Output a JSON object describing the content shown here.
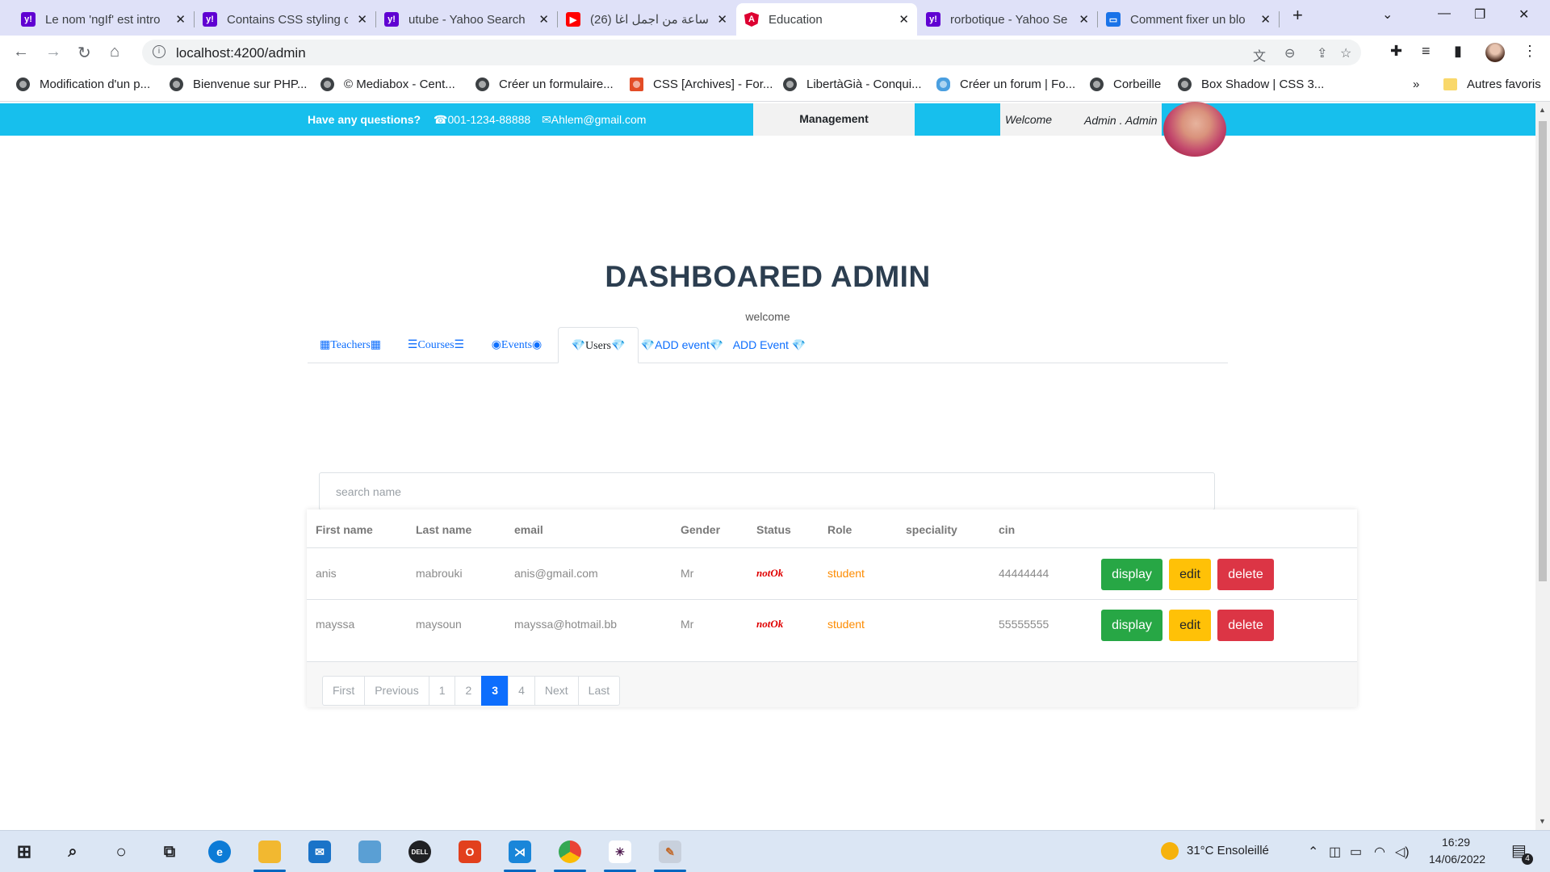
{
  "browser": {
    "tabs": [
      {
        "title": "Le nom 'ngIf' est intro",
        "icon": "yahoo-icon",
        "color": "#6001d2",
        "active": false
      },
      {
        "title": "Contains CSS styling c",
        "icon": "yahoo-icon",
        "color": "#6001d2",
        "active": false
      },
      {
        "title": "utube - Yahoo Search",
        "icon": "yahoo-icon",
        "color": "#6001d2",
        "active": false
      },
      {
        "title": "(26) ساعة من اجمل اغا",
        "icon": "youtube-icon",
        "color": "#ff0000",
        "active": false
      },
      {
        "title": "Education",
        "icon": "angular-icon",
        "color": "#dd0031",
        "active": true
      },
      {
        "title": "rorbotique - Yahoo Se",
        "icon": "yahoo-icon",
        "color": "#6001d2",
        "active": false
      },
      {
        "title": "Comment fixer un blo",
        "icon": "monitor-icon",
        "color": "#1a73e8",
        "active": false
      }
    ],
    "url": "localhost:4200/admin",
    "bookmarks": [
      "Modification d'un p...",
      "Bienvenue sur PHP...",
      "© Mediabox - Cent...",
      "Créer un formulaire...",
      "CSS [Archives] - For...",
      "LibertàGià - Conqui...",
      "Créer un forum | Fo...",
      "Corbeille",
      "Box Shadow | CSS 3..."
    ],
    "bookmarks_more": "»",
    "other_bookmarks": "Autres favoris"
  },
  "topbar": {
    "question": "Have any questions?",
    "phone": "☎001-1234-88888",
    "email": "✉Ahlem@gmail.com",
    "management": "Management",
    "welcome": "Welcome",
    "user": "Admin . Admin"
  },
  "dashboard": {
    "title": "DASHBOARED ADMIN",
    "subtitle": "welcome",
    "tabs": [
      {
        "label": "▦Teachers▦",
        "active": false
      },
      {
        "label": "☰Courses☰",
        "active": false
      },
      {
        "label": "◉Events◉",
        "active": false
      },
      {
        "label": "💎Users💎",
        "active": true
      },
      {
        "label": "💎ADD event💎",
        "active": false
      },
      {
        "label": "ADD Event 💎",
        "active": false
      }
    ],
    "search_placeholder": "search name"
  },
  "table": {
    "headers": [
      "First name",
      "Last name",
      "email",
      "Gender",
      "Status",
      "Role",
      "speciality",
      "cin"
    ],
    "rows": [
      {
        "first": "anis",
        "last": "mabrouki",
        "email": "anis@gmail.com",
        "gender": "Mr",
        "status": "notOk",
        "role": "student",
        "speciality": "",
        "cin": "44444444"
      },
      {
        "first": "mayssa",
        "last": "maysoun",
        "email": "mayssa@hotmail.bb",
        "gender": "Mr",
        "status": "notOk",
        "role": "student",
        "speciality": "",
        "cin": "55555555"
      }
    ],
    "actions": {
      "display": "display",
      "edit": "edit",
      "delete": "delete"
    }
  },
  "pagination": {
    "items": [
      "First",
      "Previous",
      "1",
      "2",
      "3",
      "4",
      "Next",
      "Last"
    ],
    "current": "3"
  },
  "taskbar": {
    "weather": "31°C  Ensoleillé",
    "time": "16:29",
    "date": "14/06/2022",
    "notifications": "4"
  }
}
